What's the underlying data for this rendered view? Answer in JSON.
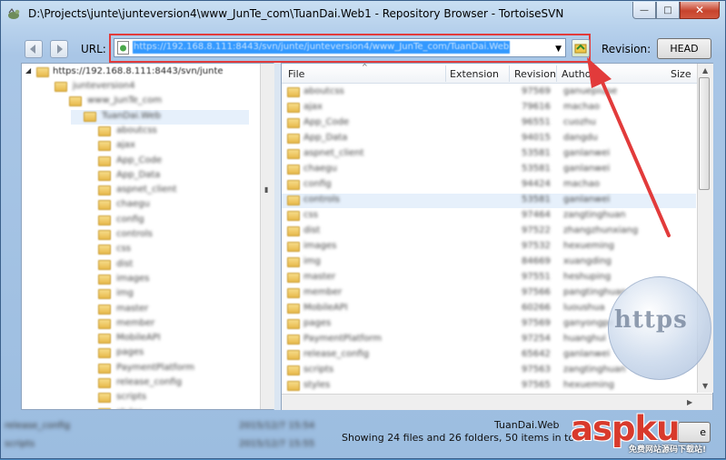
{
  "window": {
    "title": "D:\\Projects\\junte\\junteversion4\\www_JunTe_com\\TuanDai.Web1 - Repository Browser - TortoiseSVN",
    "minimize_glyph": "—",
    "maximize_glyph": "□",
    "close_glyph": "✕"
  },
  "toolbar": {
    "url_label": "URL:",
    "url_value": "https://192.168.8.111:8443/svn/junte/junteversion4/www_JunTe_com/TuanDai.Web",
    "dropdown_glyph": "▼",
    "revision_label": "Revision:",
    "head_button": "HEAD"
  },
  "tree": {
    "root": "https://192.168.8.111:8443/svn/junte",
    "items": [
      "junteversion4",
      "www_JunTe_com",
      "TuanDai.Web",
      "aboutcss",
      "ajax",
      "App_Code",
      "App_Data",
      "aspnet_client",
      "chaegu",
      "config",
      "controls",
      "css",
      "dist",
      "images",
      "img",
      "master",
      "member",
      "MobileAPI",
      "pages",
      "PaymentPlatform",
      "release_config",
      "scripts",
      "styles"
    ]
  },
  "list": {
    "columns": {
      "file": "File",
      "extension": "Extension",
      "revision": "Revision",
      "author": "Author",
      "size": "Size"
    },
    "rows": [
      {
        "name": "aboutcss",
        "rev": "97569",
        "author": "ganuepiupe"
      },
      {
        "name": "ajax",
        "rev": "79616",
        "author": "machao"
      },
      {
        "name": "App_Code",
        "rev": "96551",
        "author": "cuozhu"
      },
      {
        "name": "App_Data",
        "rev": "94015",
        "author": "dangdu"
      },
      {
        "name": "aspnet_client",
        "rev": "53581",
        "author": "ganlanwei"
      },
      {
        "name": "chaegu",
        "rev": "53581",
        "author": "ganlanwei"
      },
      {
        "name": "config",
        "rev": "94424",
        "author": "machao"
      },
      {
        "name": "controls",
        "rev": "53581",
        "author": "ganlanwei"
      },
      {
        "name": "css",
        "rev": "97464",
        "author": "zangtinghuan"
      },
      {
        "name": "dist",
        "rev": "97522",
        "author": "zhangzhunxiang"
      },
      {
        "name": "images",
        "rev": "97532",
        "author": "hexueming"
      },
      {
        "name": "img",
        "rev": "84669",
        "author": "xuangding"
      },
      {
        "name": "master",
        "rev": "97551",
        "author": "heshuping"
      },
      {
        "name": "member",
        "rev": "97566",
        "author": "pangtinghuan"
      },
      {
        "name": "MobileAPI",
        "rev": "60266",
        "author": "luoushua"
      },
      {
        "name": "pages",
        "rev": "97569",
        "author": "ganyongpe"
      },
      {
        "name": "PaymentPlatform",
        "rev": "97254",
        "author": "huanghui"
      },
      {
        "name": "release_config",
        "rev": "65642",
        "author": "ganlanwei"
      },
      {
        "name": "scripts",
        "rev": "97563",
        "author": "zangtinghuan"
      },
      {
        "name": "styles",
        "rev": "97565",
        "author": "hexueming"
      }
    ]
  },
  "background_rows": [
    {
      "name": "release_config",
      "date": "2015/12/7 15:54"
    },
    {
      "name": "scripts",
      "date": "2015/12/7 15:55"
    }
  ],
  "status": {
    "crumb": "TuanDai.Web",
    "summary": "Showing 24 files and 26 folders, 50 items in total",
    "button_fragment": "e"
  },
  "overlay": {
    "watermark_text": "https",
    "logo_main": "aspku",
    "logo_sub": "免费网站源码下载站!"
  },
  "colors": {
    "selection": "#3399ff",
    "annotation_red": "#e23b3b",
    "logo_red": "#d83a2c"
  }
}
